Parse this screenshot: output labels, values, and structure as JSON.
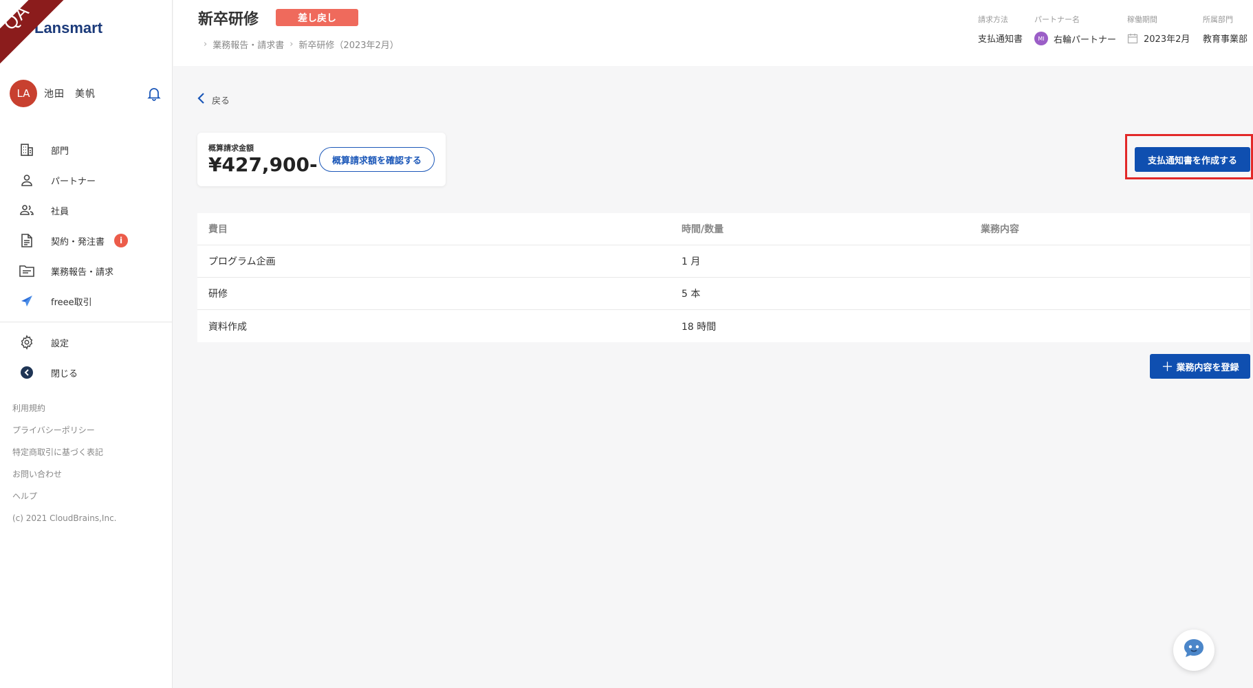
{
  "sidebar": {
    "qa_label": "QA",
    "logo": "Lansmart",
    "user": {
      "avatar_initials": "LA",
      "name": "池田　美帆"
    },
    "nav": [
      {
        "label": "部門",
        "icon": "building-icon"
      },
      {
        "label": "パートナー",
        "icon": "person-icon"
      },
      {
        "label": "社員",
        "icon": "people-icon"
      },
      {
        "label": "契約・発注書",
        "icon": "document-icon",
        "badge": "i"
      },
      {
        "label": "業務報告・請求",
        "icon": "folder-icon"
      },
      {
        "label": "freee取引",
        "icon": "freee-icon"
      }
    ],
    "nav2": [
      {
        "label": "設定",
        "icon": "gear-icon"
      },
      {
        "label": "閉じる",
        "icon": "arrow-left-circle-icon"
      }
    ],
    "footer_links": [
      "利用規約",
      "プライバシーポリシー",
      "特定商取引に基づく表記",
      "お問い合わせ",
      "ヘルプ",
      "(c) 2021 CloudBrains,Inc."
    ]
  },
  "header": {
    "title": "新卒研修",
    "status": "差し戻し",
    "breadcrumb": [
      "業務報告・請求書",
      "新卒研修（2023年2月）"
    ],
    "meta": {
      "billing_method_label": "請求方法",
      "billing_method": "支払通知書",
      "partner_label": "パートナー名",
      "partner_initials": "MI",
      "partner": "右輪パートナー",
      "period_label": "稼働期間",
      "period": "2023年2月",
      "dept_label": "所属部門",
      "dept": "教育事業部"
    }
  },
  "main": {
    "back": "戻る",
    "amount_label": "概算請求金額",
    "amount_value": "¥427,900-",
    "confirm_button": "概算請求額を確認する",
    "create_button": "支払通知書を作成する",
    "table": {
      "headers": [
        "費目",
        "時間/数量",
        "業務内容"
      ],
      "rows": [
        [
          "プログラム企画",
          "1 月",
          ""
        ],
        [
          "研修",
          "5 本",
          ""
        ],
        [
          "資料作成",
          "18 時間",
          ""
        ]
      ]
    },
    "add_button": "業務内容を登録",
    "add_button_plus": "＋"
  },
  "colors": {
    "primary": "#0f4fb0",
    "badge_red": "#ef6a5c",
    "highlight_frame": "#e22828",
    "avatar": "#c8402f"
  }
}
